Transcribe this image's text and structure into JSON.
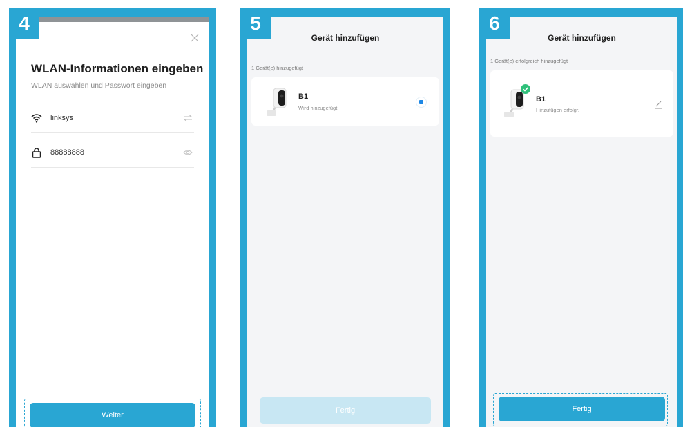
{
  "panels": [
    {
      "step": "4",
      "title": "WLAN-Informationen eingeben",
      "subtitle": "WLAN auswählen und Passwort eingeben",
      "ssid": "linksys",
      "password": "88888888",
      "button": "Weiter",
      "icons": [
        "close-icon",
        "wifi-icon",
        "switch-icon",
        "lock-icon",
        "eye-icon"
      ]
    },
    {
      "step": "5",
      "nav_title": "Gerät hinzufügen",
      "count_text": "1 Gerät(e) hinzugefügt",
      "device_name": "B1",
      "device_status": "Wird hinzugefügt",
      "button": "Fertig"
    },
    {
      "step": "6",
      "nav_title": "Gerät hinzufügen",
      "count_text": "1 Gerät(e) erfolgreich hinzugefügt",
      "device_name": "B1",
      "device_status": "Hinzufügen erfolgr.",
      "button": "Fertig"
    }
  ],
  "colors": {
    "accent": "#29a6d3",
    "success": "#2fc07a",
    "disabled_button": "#c8e7f3"
  }
}
